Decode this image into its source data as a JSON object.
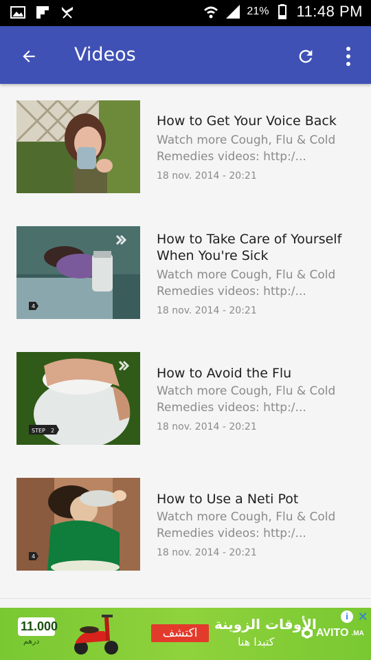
{
  "status_bar": {
    "battery": "21%",
    "time": "11:48 PM"
  },
  "app_bar": {
    "title": "Videos",
    "back_icon": "arrow-back-icon",
    "refresh_icon": "refresh-icon",
    "menu_icon": "more-vert-icon",
    "color": "#3f51b5"
  },
  "videos": [
    {
      "title": "How to Get Your Voice Back",
      "description_line1": "Watch more Cough, Flu & Cold",
      "description_line2": "Remedies videos: http:/...",
      "date": "18 nov. 2014 - 20:21"
    },
    {
      "title_line1": "How to Take Care of Yourself",
      "title_line2": "When You're Sick",
      "description_line1": "Watch more Cough, Flu & Cold",
      "description_line2": "Remedies videos: http:/...",
      "date": "18 nov. 2014 - 20:21",
      "badge": "4"
    },
    {
      "title": "How to Avoid the Flu",
      "description_line1": "Watch more Cough, Flu & Cold",
      "description_line2": "Remedies videos: http:/...",
      "date": "18 nov. 2014 - 20:21",
      "badge_label": "STEP",
      "badge": "2"
    },
    {
      "title": "How to Use a Neti Pot",
      "description_line1": "Watch more Cough, Flu & Cold",
      "description_line2": "Remedies videos: http:/...",
      "date": "18 nov. 2014 - 20:21",
      "badge": "4"
    }
  ],
  "ad": {
    "price": "11.000",
    "currency": "درهم",
    "cta": "اكتشف",
    "headline": "الأوقات الزوينة",
    "subline": "كتبدا هنا",
    "brand": "AVITO",
    "brand_suffix": ".MA",
    "info_icon": "info-icon",
    "close_icon": "close-icon"
  }
}
